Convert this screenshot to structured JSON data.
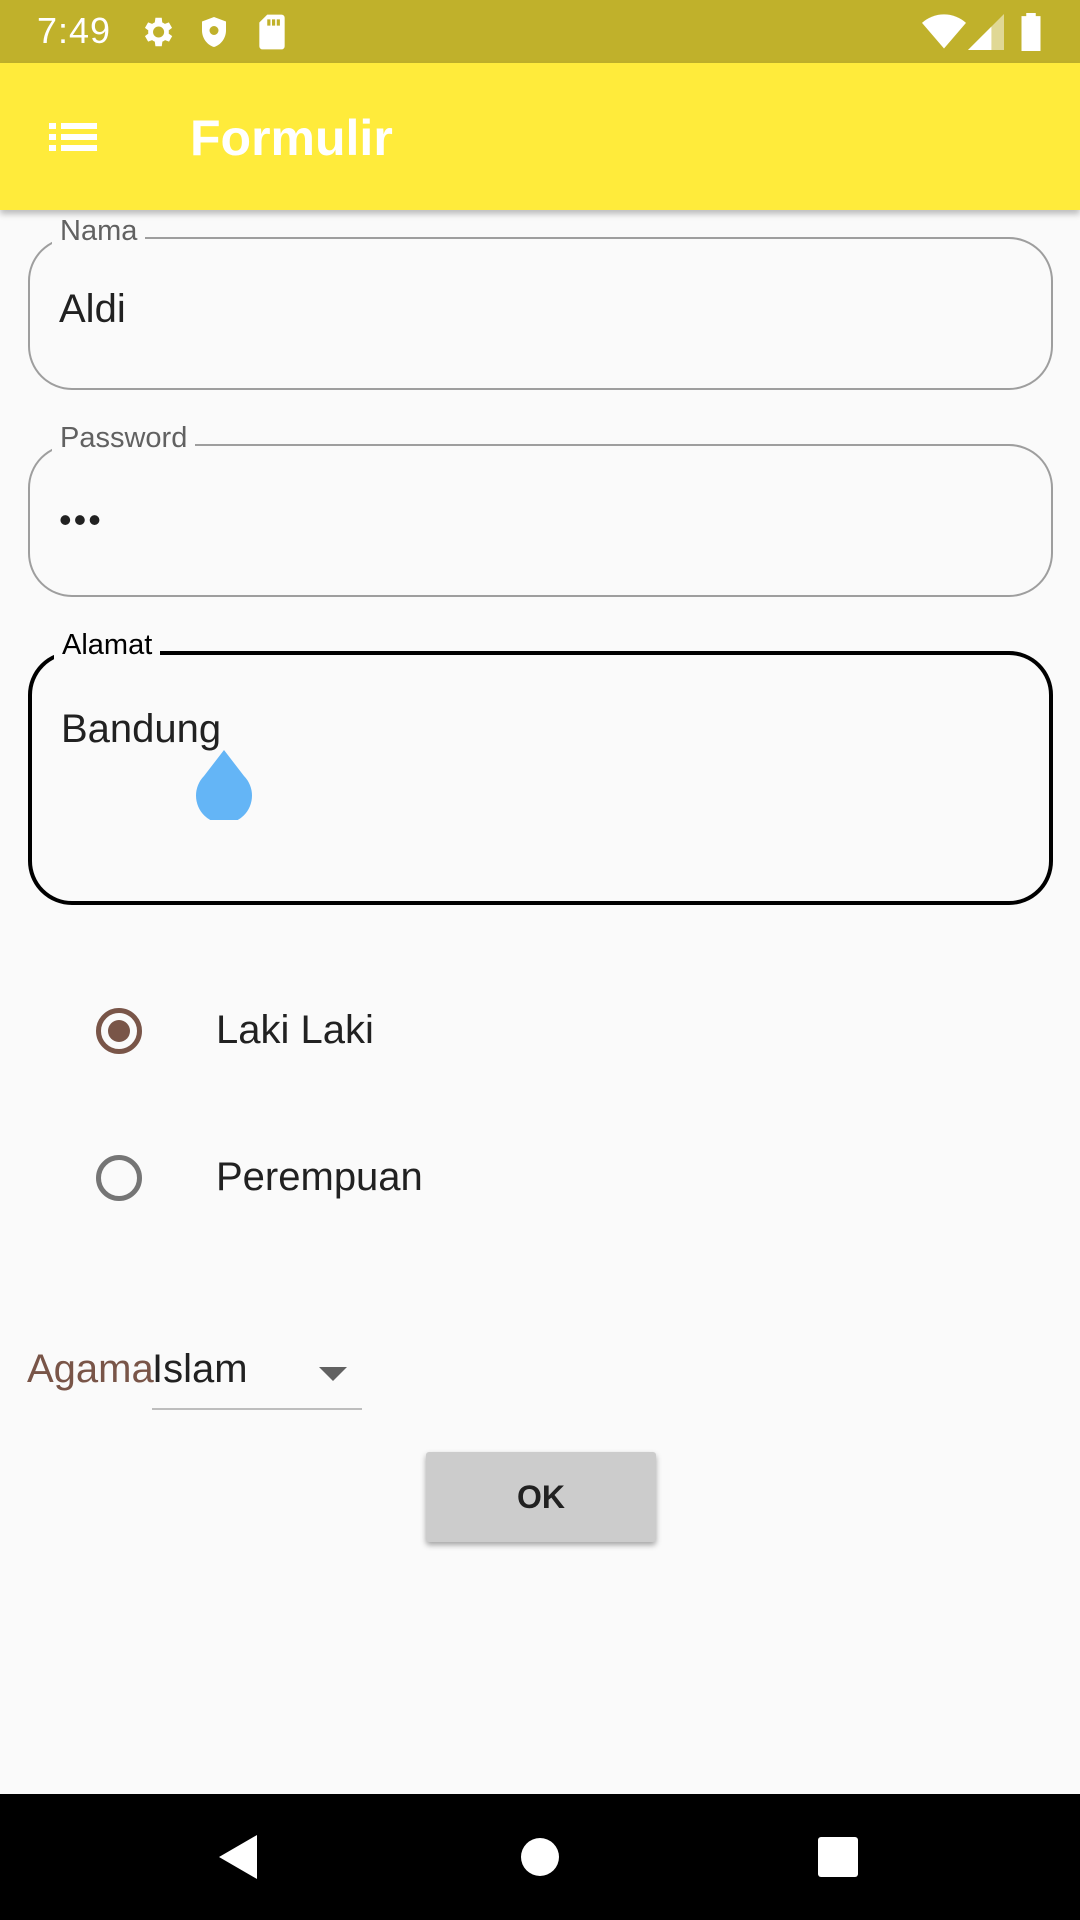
{
  "status_bar": {
    "time": "7:49",
    "icons": [
      "gear-icon",
      "shield-icon",
      "sd-card-icon",
      "wifi-icon",
      "signal-icon",
      "battery-icon"
    ]
  },
  "app_bar": {
    "title": "Formulir",
    "menu_icon": "list-icon",
    "background": "#ffeb3b"
  },
  "form": {
    "nama": {
      "label": "Nama",
      "value": "Aldi"
    },
    "password": {
      "label": "Password",
      "value": "•••"
    },
    "alamat": {
      "label": "Alamat",
      "value": "Bandung"
    },
    "gender": {
      "options": [
        {
          "label": "Laki Laki",
          "checked": true
        },
        {
          "label": "Perempuan",
          "checked": false
        }
      ]
    },
    "agama": {
      "label": "Agama",
      "selected": "Islam"
    },
    "ok_label": "OK"
  },
  "colors": {
    "accent": "#795548",
    "status_bar": "#c0b12b",
    "cursor_handle": "#64b5f6"
  },
  "nav_bar": {
    "buttons": [
      "back-icon",
      "home-icon",
      "recents-icon"
    ]
  }
}
